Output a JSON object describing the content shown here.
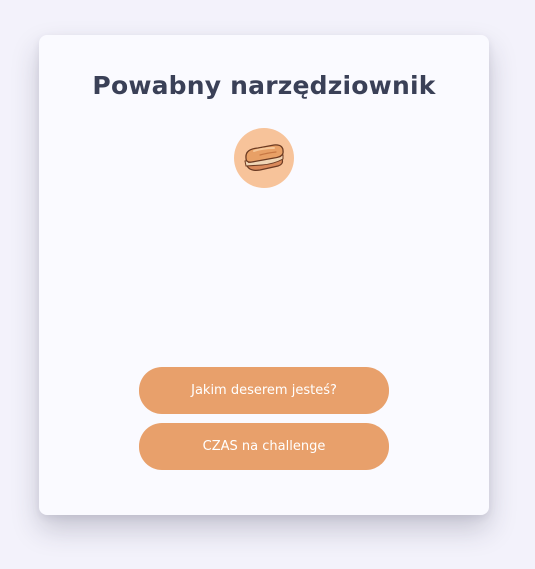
{
  "card": {
    "title": "Powabny narzędziownik",
    "avatar_icon": "sandwich-icon",
    "buttons": [
      {
        "label": "Jakim deserem jesteś?"
      },
      {
        "label": "CZAS na challenge"
      }
    ]
  },
  "colors": {
    "background": "#f3f2fb",
    "card": "#fafaff",
    "title": "#3a4057",
    "avatar_bg": "#f7c39a",
    "button": "#e8a06b",
    "button_text": "#ffffff"
  }
}
